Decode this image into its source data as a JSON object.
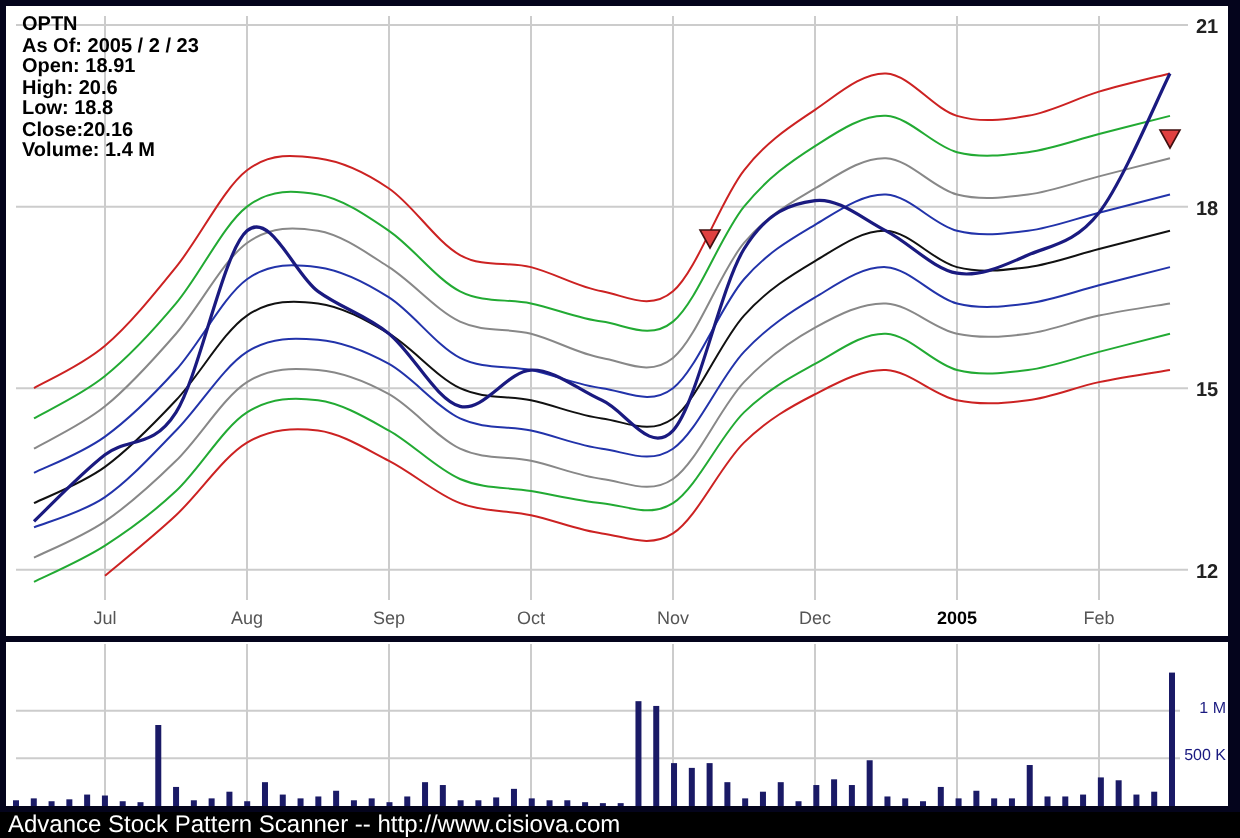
{
  "quote": {
    "symbol": "OPTN",
    "lines": [
      "As Of: 2005 / 2 / 23",
      "Open: 18.91",
      "High: 20.6",
      "Low: 18.8",
      "Close:20.16",
      "Volume: 1.4 M"
    ]
  },
  "price_chart": {
    "markers": [
      {
        "kind": "down-triangle"
      },
      {
        "kind": "down-triangle"
      }
    ],
    "chart_data": {
      "type": "line",
      "grid": true,
      "categories": [
        null,
        "Jul",
        null,
        "Aug",
        null,
        "Sep",
        null,
        "Oct",
        null,
        "Nov",
        null,
        "Dec",
        null,
        "2005",
        null,
        "Feb",
        null
      ],
      "ylim": [
        11.5,
        21.15
      ],
      "yticks": [
        12,
        15,
        18,
        21
      ],
      "series": [
        {
          "color": "#cc2222",
          "values": [
            15.0,
            15.7,
            17.0,
            18.6,
            18.8,
            18.3,
            17.2,
            17.0,
            16.6,
            16.6,
            18.6,
            19.6,
            20.2,
            19.5,
            19.5,
            19.9,
            20.2
          ]
        },
        {
          "color": "#22aa33",
          "values": [
            14.5,
            15.2,
            16.4,
            18.0,
            18.2,
            17.6,
            16.6,
            16.4,
            16.1,
            16.1,
            18.0,
            19.0,
            19.5,
            18.9,
            18.9,
            19.2,
            19.5
          ]
        },
        {
          "color": "#888888",
          "values": [
            14.0,
            14.7,
            15.9,
            17.4,
            17.6,
            17.0,
            16.1,
            15.9,
            15.5,
            15.5,
            17.4,
            18.3,
            18.8,
            18.2,
            18.2,
            18.5,
            18.8
          ]
        },
        {
          "color": "#2233aa",
          "values": [
            13.6,
            14.2,
            15.3,
            16.8,
            17.0,
            16.5,
            15.5,
            15.3,
            15.0,
            15.0,
            16.8,
            17.7,
            18.2,
            17.6,
            17.6,
            17.9,
            18.2
          ]
        },
        {
          "color": "#111111",
          "values": [
            13.1,
            13.7,
            14.8,
            16.2,
            16.4,
            15.9,
            15.0,
            14.8,
            14.5,
            14.5,
            16.2,
            17.1,
            17.6,
            17.0,
            17.0,
            17.3,
            17.6
          ]
        },
        {
          "color": "#2233aa",
          "values": [
            12.7,
            13.2,
            14.3,
            15.6,
            15.8,
            15.4,
            14.5,
            14.3,
            14.0,
            14.0,
            15.6,
            16.5,
            17.0,
            16.4,
            16.4,
            16.7,
            17.0
          ]
        },
        {
          "color": "#888888",
          "values": [
            12.2,
            12.8,
            13.8,
            15.1,
            15.3,
            14.9,
            14.0,
            13.8,
            13.5,
            13.5,
            15.1,
            16.0,
            16.4,
            15.9,
            15.9,
            16.2,
            16.4
          ]
        },
        {
          "color": "#22aa33",
          "values": [
            11.8,
            12.4,
            13.3,
            14.6,
            14.8,
            14.3,
            13.5,
            13.3,
            13.1,
            13.1,
            14.6,
            15.4,
            15.9,
            15.3,
            15.3,
            15.6,
            15.9
          ]
        },
        {
          "color": "#cc2222",
          "values": [
            null,
            11.9,
            12.9,
            14.1,
            14.3,
            13.8,
            13.1,
            12.9,
            12.6,
            12.6,
            14.1,
            14.9,
            15.3,
            14.8,
            14.8,
            15.1,
            15.3
          ]
        },
        {
          "color": "#1a1a80",
          "values": [
            12.8,
            13.9,
            14.6,
            17.6,
            16.6,
            15.9,
            14.7,
            15.3,
            14.8,
            14.3,
            17.3,
            18.1,
            17.6,
            16.9,
            17.2,
            17.9,
            20.2
          ]
        }
      ]
    }
  },
  "volume_chart": {
    "chart_data": {
      "type": "bar",
      "grid": true,
      "ylim": [
        0,
        1700000
      ],
      "yticks": [
        {
          "value": 500000,
          "label": "500 K"
        },
        {
          "value": 1000000,
          "label": "1 M"
        }
      ],
      "series": [
        {
          "color": "#1a1a66",
          "values": [
            60000,
            80000,
            50000,
            70000,
            120000,
            110000,
            50000,
            40000,
            850000,
            200000,
            60000,
            80000,
            150000,
            50000,
            250000,
            120000,
            80000,
            100000,
            160000,
            60000,
            80000,
            40000,
            100000,
            250000,
            220000,
            60000,
            60000,
            90000,
            180000,
            80000,
            60000,
            60000,
            40000,
            30000,
            30000,
            1100000,
            1050000,
            450000,
            400000,
            450000,
            250000,
            80000,
            150000,
            250000,
            50000,
            220000,
            280000,
            220000,
            480000,
            100000,
            80000,
            50000,
            200000,
            80000,
            160000,
            80000,
            80000,
            430000,
            100000,
            100000,
            120000,
            300000,
            270000,
            120000,
            150000,
            1400000
          ]
        }
      ]
    }
  },
  "footer": "Advance Stock Pattern Scanner -- http://www.cisiova.com"
}
